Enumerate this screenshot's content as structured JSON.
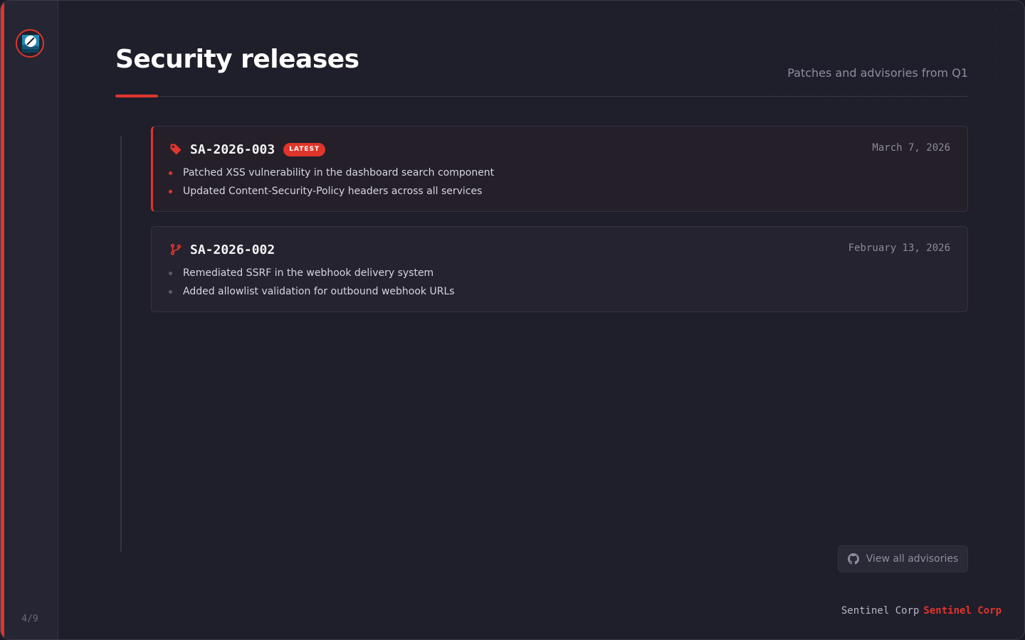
{
  "colors": {
    "accent": "#e0352b",
    "background": "#1f1e2b",
    "sidebar": "#262533",
    "card": "#24232f"
  },
  "sidebar": {
    "logo_icon": "shield-slash-icon",
    "page_counter": "4/9"
  },
  "header": {
    "title": "Security releases",
    "subtitle": "Patches and advisories from Q1"
  },
  "releases": [
    {
      "id": "SA-2026-003",
      "icon": "tag-icon",
      "badge": "LATEST",
      "date": "March 7, 2026",
      "items": [
        "Patched XSS vulnerability in the dashboard search component",
        "Updated Content-Security-Policy headers across all services"
      ]
    },
    {
      "id": "SA-2026-002",
      "icon": "git-branch-icon",
      "badge": "",
      "date": "February 13, 2026",
      "items": [
        "Remediated SSRF in the webhook delivery system",
        "Added allowlist validation for outbound webhook URLs"
      ]
    }
  ],
  "actions": {
    "view_all_label": "View all advisories",
    "view_all_icon": "github-icon"
  },
  "footer": {
    "brand": "Sentinel Corp",
    "brand_accent": "Sentinel Corp"
  }
}
